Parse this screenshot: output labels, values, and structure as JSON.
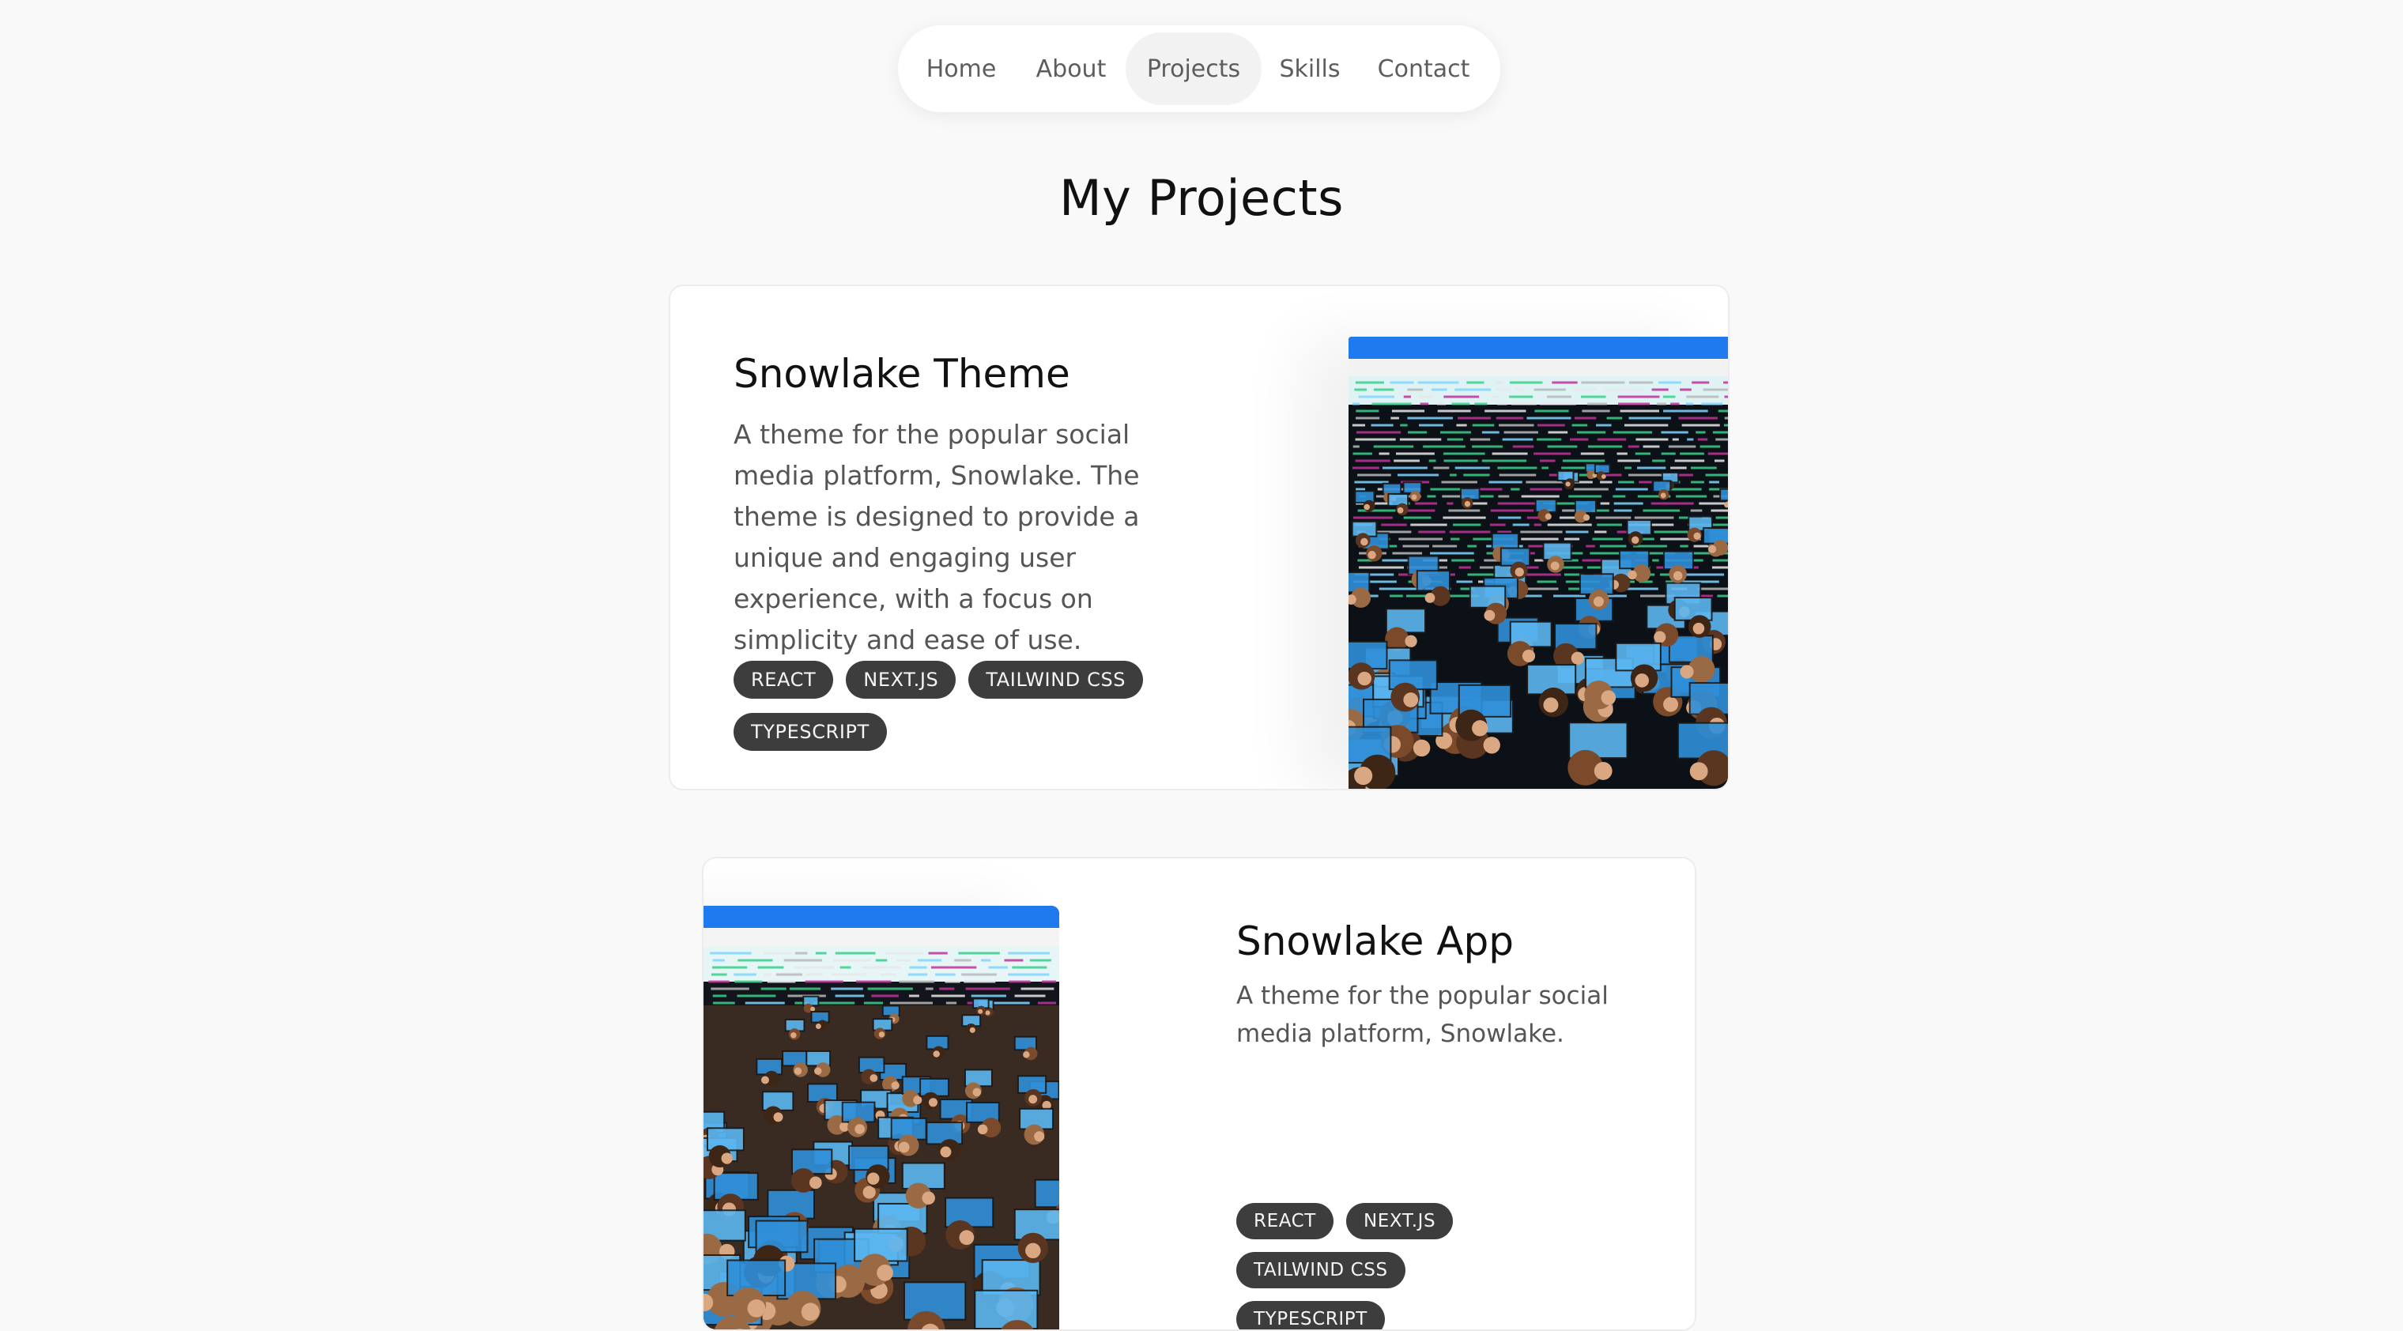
{
  "nav": {
    "items": [
      {
        "label": "Home"
      },
      {
        "label": "About"
      },
      {
        "label": "Projects"
      },
      {
        "label": "Skills"
      },
      {
        "label": "Contact"
      }
    ],
    "active": "Projects"
  },
  "page": {
    "title": "My Projects"
  },
  "projects": [
    {
      "title": "Snowlake Theme",
      "description": "A theme for the popular social media platform, Snowlake. The theme is designed to provide a unique and engaging user experience, with a focus on simplicity and ease of use.",
      "tags": [
        "REACT",
        "NEXT.JS",
        "TAILWIND CSS",
        "TYPESCRIPT"
      ]
    },
    {
      "title": "Snowlake App",
      "description": "A theme for the popular social media platform, Snowlake.",
      "tags": [
        "REACT",
        "NEXT.JS",
        "TAILWIND CSS",
        "TYPESCRIPT"
      ]
    }
  ],
  "colors": {
    "background": "#f9f9f9",
    "tag_background": "#3d3d3d",
    "screenshot_titlebar": "#1f7af0",
    "code_green": "#3ad08a",
    "code_magenta": "#c0329a"
  }
}
